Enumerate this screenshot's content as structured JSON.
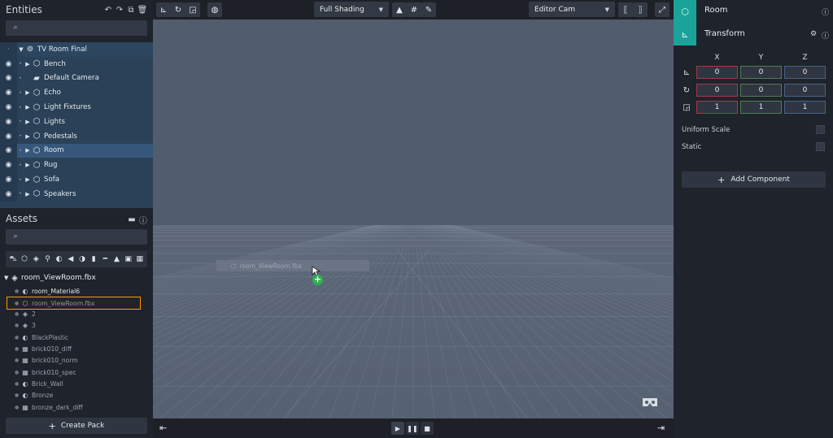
{
  "entities": {
    "title": "Entities",
    "root": "TV Room Final",
    "items": [
      {
        "label": "Bench",
        "expandable": true
      },
      {
        "label": "Default Camera",
        "expandable": false
      },
      {
        "label": "Echo",
        "expandable": true
      },
      {
        "label": "Light Fixtures",
        "expandable": true
      },
      {
        "label": "Lights",
        "expandable": true
      },
      {
        "label": "Pedestals",
        "expandable": true
      },
      {
        "label": "Room",
        "expandable": true,
        "selected": true
      },
      {
        "label": "Rug",
        "expandable": true
      },
      {
        "label": "Sofa",
        "expandable": true
      },
      {
        "label": "Speakers",
        "expandable": true
      }
    ]
  },
  "assets": {
    "title": "Assets",
    "root": "room_ViewRoom.fbx",
    "items": [
      {
        "label": "room_Material6",
        "icon": "material-icon",
        "bright": true
      },
      {
        "label": "room_ViewRoom.fbx",
        "icon": "mesh-icon",
        "highlight": true
      },
      {
        "label": "2",
        "icon": "box-icon"
      },
      {
        "label": "3",
        "icon": "box-icon"
      },
      {
        "label": "BlackPlastic",
        "icon": "material-icon"
      },
      {
        "label": "brick010_diff",
        "icon": "texture-icon"
      },
      {
        "label": "brick010_norm",
        "icon": "texture-icon"
      },
      {
        "label": "brick010_spec",
        "icon": "texture-icon"
      },
      {
        "label": "Brick_Wall",
        "icon": "material-icon"
      },
      {
        "label": "Bronze",
        "icon": "material-icon"
      },
      {
        "label": "bronze_dark_diff",
        "icon": "texture-icon"
      }
    ],
    "create_pack": "Create Pack"
  },
  "viewport": {
    "shading": "Full Shading",
    "camera": "Editor Cam",
    "drag_label": "room_ViewRoom.fbx"
  },
  "inspector": {
    "entity_name": "Room",
    "component_name": "Transform",
    "axes": [
      "X",
      "Y",
      "Z"
    ],
    "position": [
      "0",
      "0",
      "0"
    ],
    "rotation": [
      "0",
      "0",
      "0"
    ],
    "scale": [
      "1",
      "1",
      "1"
    ],
    "uniform_scale_label": "Uniform Scale",
    "static_label": "Static",
    "add_component": "Add Component"
  },
  "colors": {
    "accent": "#1aa39a",
    "selection": "#f39c12"
  }
}
